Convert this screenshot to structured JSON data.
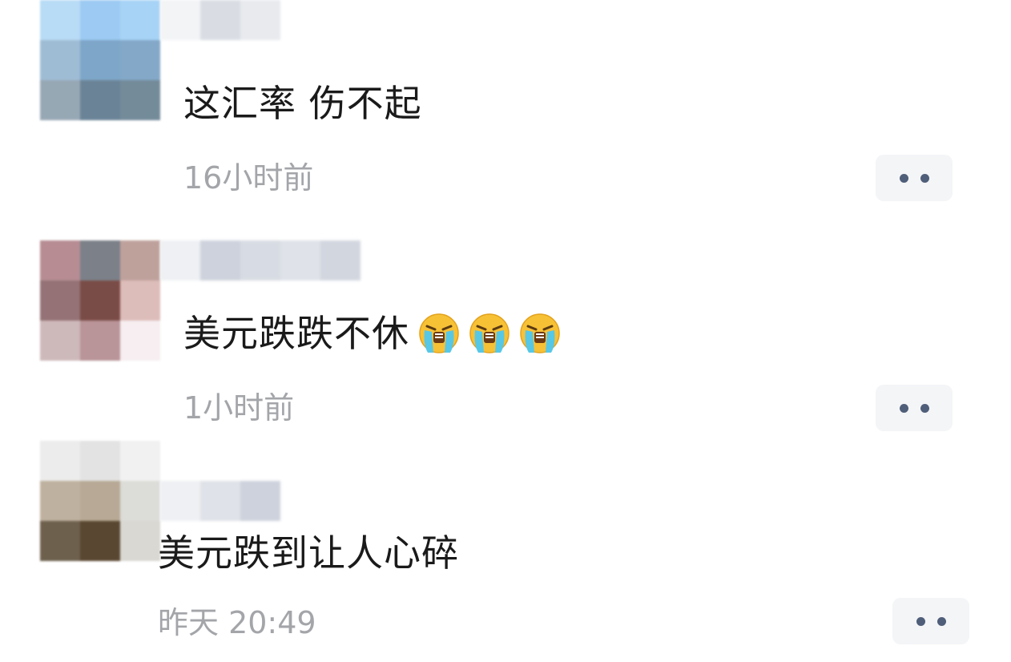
{
  "comments": [
    {
      "text": "这汇率  伤不起",
      "time": "16小时前",
      "avatar_tiles": [
        "#b9dcf6",
        "#9ccaf2",
        "#a7d3f6",
        "#9fbcd5",
        "#7ea6c8",
        "#83a8c8",
        "#97a8b5",
        "#6b8397",
        "#748b9a"
      ],
      "name_tiles": [
        "#f3f4f6",
        "#d9dde3",
        "#e8eaee"
      ],
      "more_icon": "more-dots-icon"
    },
    {
      "text": "美元跌跌不休",
      "emoji_count": 3,
      "emoji_name": "loudly-crying-face",
      "time": "1小时前",
      "avatar_tiles": [
        "#b78d93",
        "#7b8089",
        "#bfa19c",
        "#947275",
        "#7a4c47",
        "#ddbdb9",
        "#ceb9ba",
        "#b99498",
        "#f6eef0"
      ],
      "name_tiles": [
        "#eef0f3",
        "#cdd2dc",
        "#d7dbe3",
        "#dfe2e8",
        "#d2d6df"
      ],
      "more_icon": "more-dots-icon"
    },
    {
      "text": "美元跌到让人心碎",
      "time": "昨天 20:49",
      "avatar_tiles": [
        "#ececec",
        "#e3e3e3",
        "#f1f1f1",
        "#bfb19f",
        "#b7a995",
        "#dcdcd8",
        "#6d604c",
        "#5a4731",
        "#d9d8d2"
      ],
      "name_tiles": [
        "#eef0f3",
        "#dfe2e8",
        "#cdd2dc"
      ],
      "more_icon": "more-dots-icon"
    }
  ]
}
